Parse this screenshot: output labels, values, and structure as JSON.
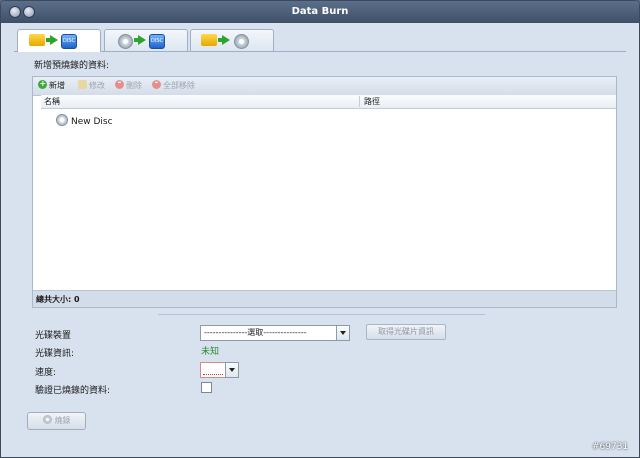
{
  "window": {
    "title": "Data Burn"
  },
  "tabs": [
    {
      "name": "data-to-disc",
      "active": true
    },
    {
      "name": "disc-to-disc",
      "active": false
    },
    {
      "name": "folder-to-disc",
      "active": false
    }
  ],
  "panel": {
    "title": "新增預燒錄的資料:",
    "toolbar": {
      "add": "新增",
      "edit": "修改",
      "delete": "刪除",
      "remove_all": "全部移除"
    },
    "columns": {
      "name": "名稱",
      "path": "路徑"
    },
    "tree": {
      "item": "New Disc"
    },
    "total": "總共大小: 0"
  },
  "form": {
    "drive_label": "光碟裝置",
    "drive_select": "---------------選取---------------",
    "get_info_button": "取得光碟片資訊",
    "info_label": "光碟資訊:",
    "info_value": "未知",
    "speed_label": "速度:",
    "verify_label": "驗證已燒錄的資料:"
  },
  "burn_button": "燒錄",
  "watermark": "#69731",
  "colors": {
    "accent_green": "#2c8a2c",
    "titlebar": "#4a5c76",
    "window_bg": "#d8e2ee"
  }
}
